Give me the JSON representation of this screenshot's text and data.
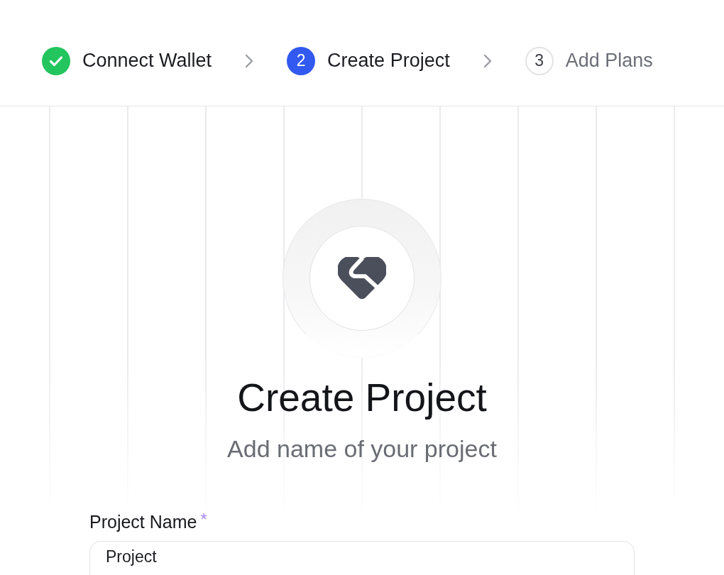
{
  "stepper": {
    "steps": [
      {
        "label": "Connect Wallet",
        "completed": true,
        "selected": false
      },
      {
        "number": "2",
        "label": "Create Project",
        "completed": false,
        "selected": true
      },
      {
        "number": "3",
        "label": "Add Plans",
        "completed": false,
        "selected": false
      }
    ]
  },
  "hero": {
    "title": "Create Project",
    "subtitle": "Add name of your project"
  },
  "form": {
    "fields": [
      {
        "label": "Project Name",
        "required_mark": "*",
        "value": "Project"
      }
    ]
  }
}
